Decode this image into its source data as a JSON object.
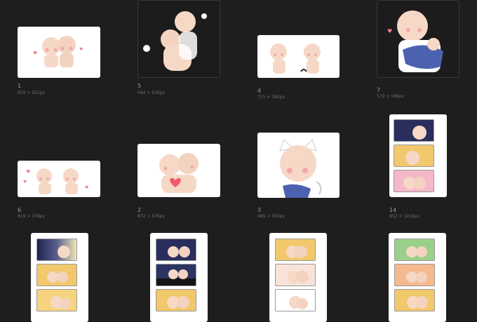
{
  "gallery": {
    "items": [
      {
        "label": "1",
        "size": "819 × 521px",
        "style": "white",
        "content": "two chibi bases waving"
      },
      {
        "label": "5",
        "size": "564 × 529px",
        "style": "dark",
        "content": "chibi pair hugging"
      },
      {
        "label": "4",
        "size": "715 × 381px",
        "style": "white",
        "content": "two chibi bases"
      },
      {
        "label": "7",
        "size": "579 × 586px",
        "style": "dark",
        "content": "chibi holding baby"
      },
      {
        "label": "6",
        "size": "819 × 378px",
        "style": "white",
        "content": "two chibis with hearts"
      },
      {
        "label": "2",
        "size": "872 × 576px",
        "style": "white",
        "content": "chibis holding heart"
      },
      {
        "label": "3",
        "size": "495 × 392px",
        "style": "white",
        "content": "cat-ear chibi"
      },
      {
        "label": "14",
        "size": "852 × 1218px",
        "style": "white",
        "content": "three-panel comic"
      },
      {
        "label": "",
        "size": "",
        "style": "white",
        "content": "three-panel comic night"
      },
      {
        "label": "",
        "size": "",
        "style": "white",
        "content": "three-panel comic city"
      },
      {
        "label": "",
        "size": "",
        "style": "white",
        "content": "three-panel comic warm"
      },
      {
        "label": "",
        "size": "",
        "style": "white",
        "content": "three-panel comic green"
      }
    ]
  },
  "colors": {
    "background": "#1e1e1e",
    "skin": "#f6d8c6",
    "blush": "#f3a8ae",
    "navy": "#2a2e5c",
    "yellow": "#f2c86c",
    "pink": "#f2a0b8",
    "blue_cloth": "#4c62b0",
    "green": "#9bd08a"
  }
}
